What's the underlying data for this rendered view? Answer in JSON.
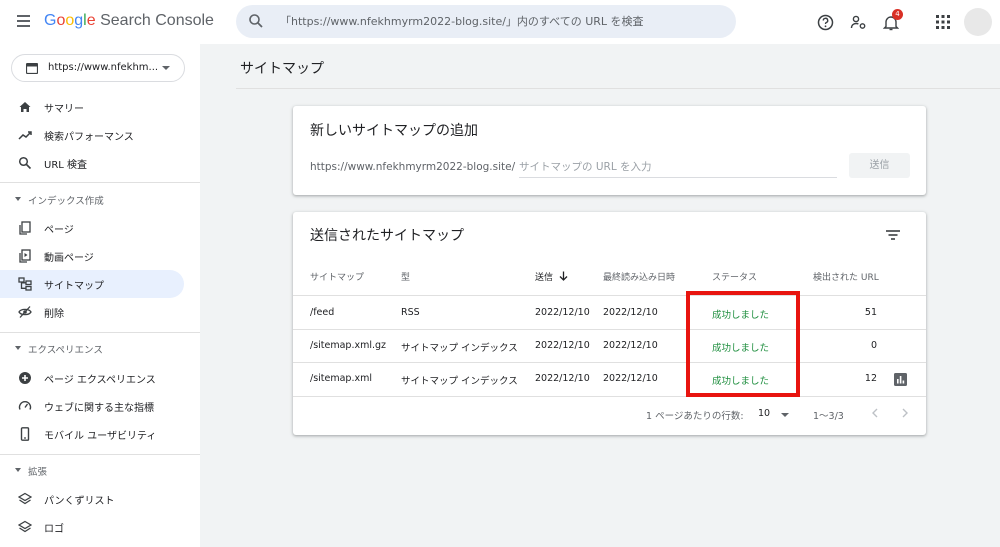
{
  "header": {
    "logo": {
      "g": "G",
      "o1": "o",
      "o2": "o",
      "g2": "g",
      "l": "l",
      "e": "e",
      "product": "Search Console"
    },
    "search_placeholder": "「https://www.nfekhmyrm2022-blog.site/」内のすべての URL を検査",
    "notification_count": "4",
    "icons": [
      "menu-icon",
      "search-icon",
      "help-icon",
      "account-settings-icon",
      "notifications-icon",
      "apps-icon"
    ]
  },
  "sidebar": {
    "property": "https://www.nfekhm...",
    "items": [
      {
        "label": "サマリー",
        "icon": "home-icon"
      },
      {
        "label": "検索パフォーマンス",
        "icon": "trending-icon"
      },
      {
        "label": "URL 検査",
        "icon": "search-icon"
      }
    ],
    "sections": [
      {
        "title": "インデックス作成",
        "items": [
          {
            "label": "ページ",
            "icon": "pages-icon"
          },
          {
            "label": "動画ページ",
            "icon": "video-pages-icon"
          },
          {
            "label": "サイトマップ",
            "icon": "sitemap-icon"
          },
          {
            "label": "削除",
            "icon": "removals-icon"
          }
        ]
      },
      {
        "title": "エクスペリエンス",
        "items": [
          {
            "label": "ページ エクスペリエンス",
            "icon": "page-experience-icon"
          },
          {
            "label": "ウェブに関する主な指標",
            "icon": "core-web-vitals-icon"
          },
          {
            "label": "モバイル ユーザビリティ",
            "icon": "mobile-icon"
          }
        ]
      },
      {
        "title": "拡張",
        "items": [
          {
            "label": "パンくずリスト",
            "icon": "layers-icon"
          },
          {
            "label": "ロゴ",
            "icon": "layers-icon"
          }
        ]
      }
    ],
    "active_item": "サイトマップ"
  },
  "main": {
    "page_title": "サイトマップ",
    "add_card": {
      "title": "新しいサイトマップの追加",
      "url_prefix": "https://www.nfekhmyrm2022-blog.site/",
      "input_placeholder": "サイトマップの URL を入力",
      "submit_label": "送信"
    },
    "submitted_card": {
      "title": "送信されたサイトマップ",
      "columns": {
        "sitemap": "サイトマップ",
        "type": "型",
        "submitted": "送信",
        "last_read": "最終読み込み日時",
        "status": "ステータス",
        "discovered": "検出された URL"
      },
      "rows": [
        {
          "sitemap": "/feed",
          "type": "RSS",
          "submitted": "2022/12/10",
          "last_read": "2022/12/10",
          "status": "成功しました",
          "discovered": "51"
        },
        {
          "sitemap": "/sitemap.xml.gz",
          "type": "サイトマップ インデックス",
          "submitted": "2022/12/10",
          "last_read": "2022/12/10",
          "status": "成功しました",
          "discovered": "0"
        },
        {
          "sitemap": "/sitemap.xml",
          "type": "サイトマップ インデックス",
          "submitted": "2022/12/10",
          "last_read": "2022/12/10",
          "status": "成功しました",
          "discovered": "12"
        }
      ],
      "footer": {
        "rows_per_page_label": "1 ページあたりの行数:",
        "rows_per_page_value": "10",
        "range": "1〜3/3"
      }
    }
  },
  "colors": {
    "accent_active": "#e8f0fe",
    "status_success": "#1e8e3e",
    "highlight_box": "#e8140f",
    "badge": "#d93025"
  }
}
